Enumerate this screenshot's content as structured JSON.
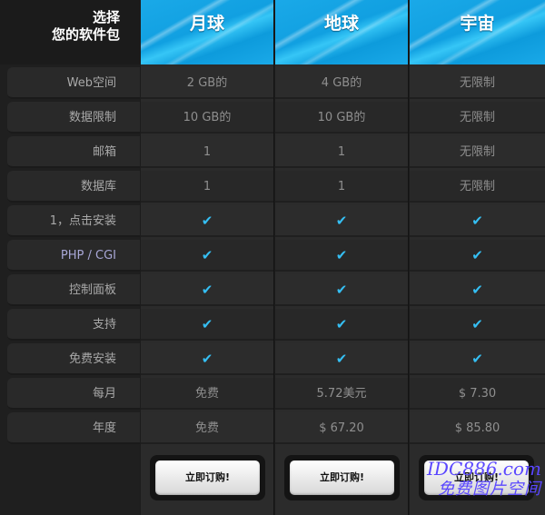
{
  "header": {
    "line1": "选择",
    "line2": "您的软件包"
  },
  "plans": [
    {
      "name": "月球",
      "order_label": "立即订购!"
    },
    {
      "name": "地球",
      "order_label": "立即订购!"
    },
    {
      "name": "宇宙",
      "order_label": "立即订购!"
    }
  ],
  "features": [
    {
      "label": "Web空间",
      "values": [
        "2 GB的",
        "4 GB的",
        "无限制"
      ]
    },
    {
      "label": "数据限制",
      "values": [
        "10 GB的",
        "10 GB的",
        "无限制"
      ]
    },
    {
      "label": "邮箱",
      "values": [
        "1",
        "1",
        "无限制"
      ]
    },
    {
      "label": "数据库",
      "values": [
        "1",
        "1",
        "无限制"
      ]
    },
    {
      "label": "1，点击安装",
      "values": [
        "✔",
        "✔",
        "✔"
      ]
    },
    {
      "label": "PHP / CGI",
      "values": [
        "✔",
        "✔",
        "✔"
      ]
    },
    {
      "label": "控制面板",
      "values": [
        "✔",
        "✔",
        "✔"
      ]
    },
    {
      "label": "支持",
      "values": [
        "✔",
        "✔",
        "✔"
      ]
    },
    {
      "label": "免费安装",
      "values": [
        "✔",
        "✔",
        "✔"
      ]
    },
    {
      "label": "每月",
      "values": [
        "免费",
        "5.72美元",
        "$ 7.30"
      ]
    },
    {
      "label": "年度",
      "values": [
        "免费",
        "$ 67.20",
        "$ 85.80"
      ]
    }
  ],
  "watermark": {
    "line1": "IDC886.com",
    "line2": "免费图片空间"
  },
  "colors": {
    "accent": "#1aa9e8",
    "check": "#35bff3"
  }
}
